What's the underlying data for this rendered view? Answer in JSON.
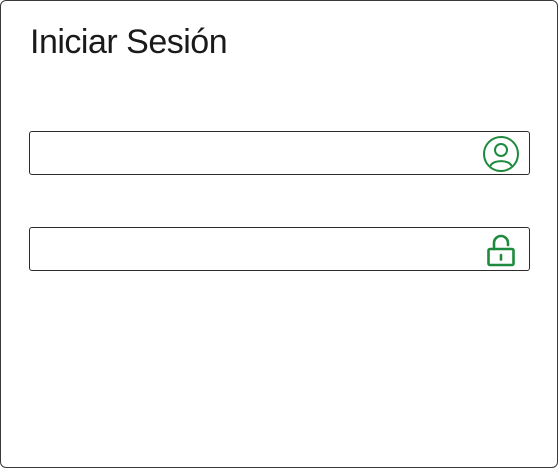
{
  "login": {
    "title": "Iniciar Sesión",
    "username": {
      "value": "",
      "placeholder": "",
      "icon": "user-circle-icon"
    },
    "password": {
      "value": "",
      "placeholder": "",
      "icon": "lock-open-icon"
    }
  },
  "colors": {
    "icon_accent": "#1e8a3e",
    "border": "#2b2b2b",
    "text": "#1a1a1a"
  }
}
